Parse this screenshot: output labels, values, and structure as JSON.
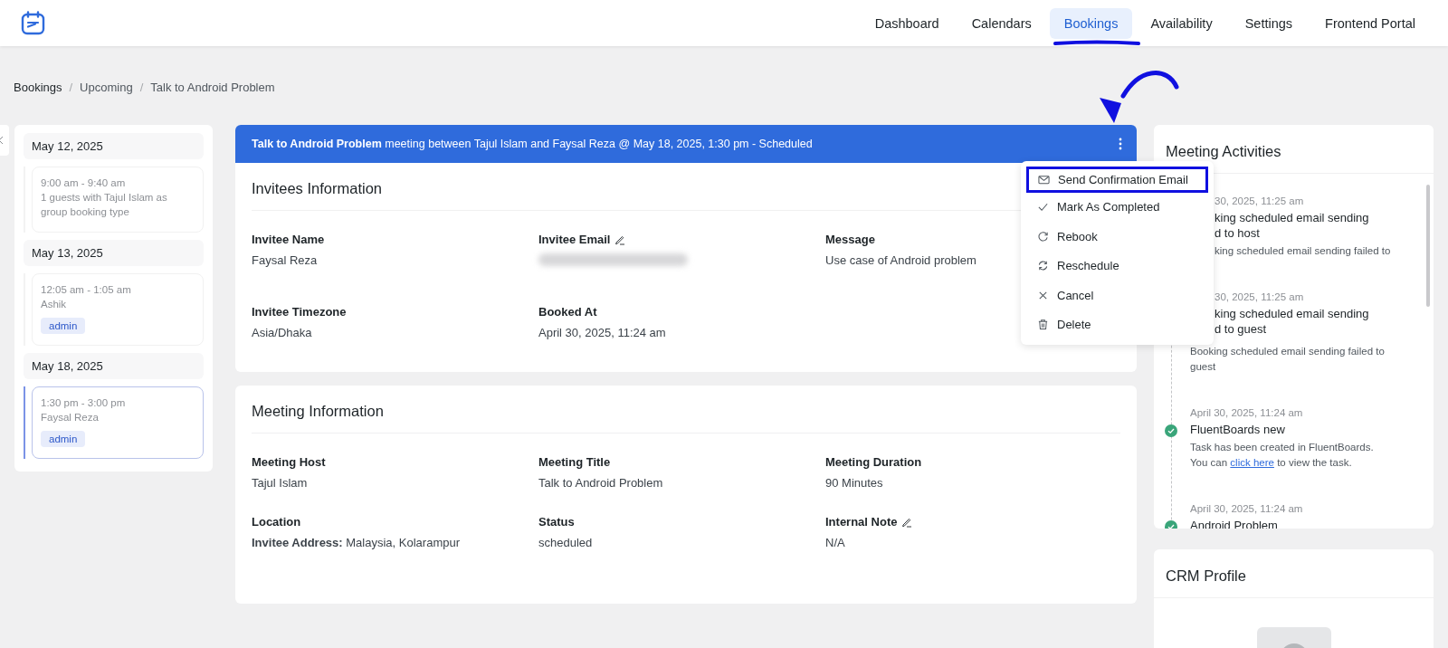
{
  "nav": {
    "items": [
      {
        "label": "Dashboard",
        "selected": false
      },
      {
        "label": "Calendars",
        "selected": false
      },
      {
        "label": "Bookings",
        "selected": true
      },
      {
        "label": "Availability",
        "selected": false
      },
      {
        "label": "Settings",
        "selected": false
      },
      {
        "label": "Frontend Portal",
        "selected": false
      }
    ]
  },
  "breadcrumb": {
    "separator": "/",
    "items": [
      "Bookings",
      "Upcoming",
      "Talk to Android Problem"
    ]
  },
  "sidebar": {
    "groups": [
      {
        "date": "May 12, 2025",
        "bookings": [
          {
            "time": "9:00 am - 9:40 am",
            "text": "1 guests with Tajul Islam as group booking type",
            "selected": false
          }
        ]
      },
      {
        "date": "May 13, 2025",
        "bookings": [
          {
            "time": "12:05 am - 1:05 am",
            "text": "Ashik",
            "tag": "admin",
            "selected": false
          }
        ]
      },
      {
        "date": "May 18, 2025",
        "bookings": [
          {
            "time": "1:30 pm - 3:00 pm",
            "text": "Faysal Reza",
            "tag": "admin",
            "selected": true
          }
        ]
      }
    ]
  },
  "booking_header": "**Talk to Android Problem** meeting between Tajul Islam and Faysal Reza @ May 18, 2025, 1:30 pm - Scheduled",
  "menu": {
    "items": [
      {
        "kind": "mail",
        "label": "Send Confirmation Email",
        "highlighted": true
      },
      {
        "kind": "check",
        "label": "Mark As Completed",
        "highlighted": false
      },
      {
        "kind": "rebook",
        "label": "Rebook",
        "highlighted": false
      },
      {
        "kind": "reschedule",
        "label": "Reschedule",
        "highlighted": false
      },
      {
        "kind": "cancel",
        "label": "Cancel",
        "highlighted": false
      },
      {
        "kind": "delete",
        "label": "Delete",
        "highlighted": false
      }
    ]
  },
  "sections": [
    {
      "title": "Invitees Information",
      "fields": [
        {
          "label": "Invitee Name",
          "value": "Faysal Reza",
          "kind": "text",
          "editable": false
        },
        {
          "label": "Invitee Email",
          "kind": "redacted",
          "editable": true
        },
        {
          "label": "Message",
          "value": "Use case of Android problem",
          "kind": "text",
          "editable": false
        },
        {
          "label": "Invitee Timezone",
          "value": "Asia/Dhaka",
          "kind": "text",
          "editable": false
        },
        {
          "label": "Booked At",
          "value": "April 30, 2025, 11:24 am",
          "kind": "text",
          "editable": false
        }
      ]
    },
    {
      "title": "Meeting Information",
      "fields": [
        {
          "label": "Meeting Host",
          "value": "Tajul Islam",
          "kind": "text",
          "editable": false
        },
        {
          "label": "Meeting Title",
          "value": "Talk to Android Problem",
          "kind": "text",
          "editable": false
        },
        {
          "label": "Meeting Duration",
          "value": "90 Minutes",
          "kind": "text",
          "editable": false
        },
        {
          "label": "Location",
          "value": "**Invitee Address:** Malaysia, Kolarampur",
          "kind": "text",
          "editable": false
        },
        {
          "label": "Status",
          "value": "scheduled",
          "kind": "text",
          "editable": false
        },
        {
          "label": "Internal Note",
          "value": "N/A",
          "kind": "text",
          "editable": true
        }
      ]
    }
  ],
  "activities": {
    "title": "Meeting Activities",
    "items": [
      {
        "kind": "partial",
        "time": "30, 2025, 11:25 am",
        "title_lines": [
          "king scheduled email sending",
          "d to host"
        ],
        "description": "king scheduled email sending failed to",
        "description_covered": true
      },
      {
        "kind": "partial",
        "time": "30, 2025, 11:25 am",
        "title_lines": [
          "king scheduled email sending",
          "d to guest"
        ],
        "description": "Booking scheduled email sending failed to guest",
        "description_covered": false
      },
      {
        "kind": "full",
        "time": "April 30, 2025, 11:24 am",
        "title_lines": [
          "FluentBoards new"
        ],
        "description": "Task has been created in FluentBoards.",
        "description_2": "You can",
        "link": "click here",
        "description_after": "to view the task."
      },
      {
        "kind": "full",
        "time": "April 30, 2025, 11:24 am",
        "title_lines": [
          "Android Problem"
        ]
      }
    ]
  },
  "crm": {
    "title": "CRM Profile"
  }
}
